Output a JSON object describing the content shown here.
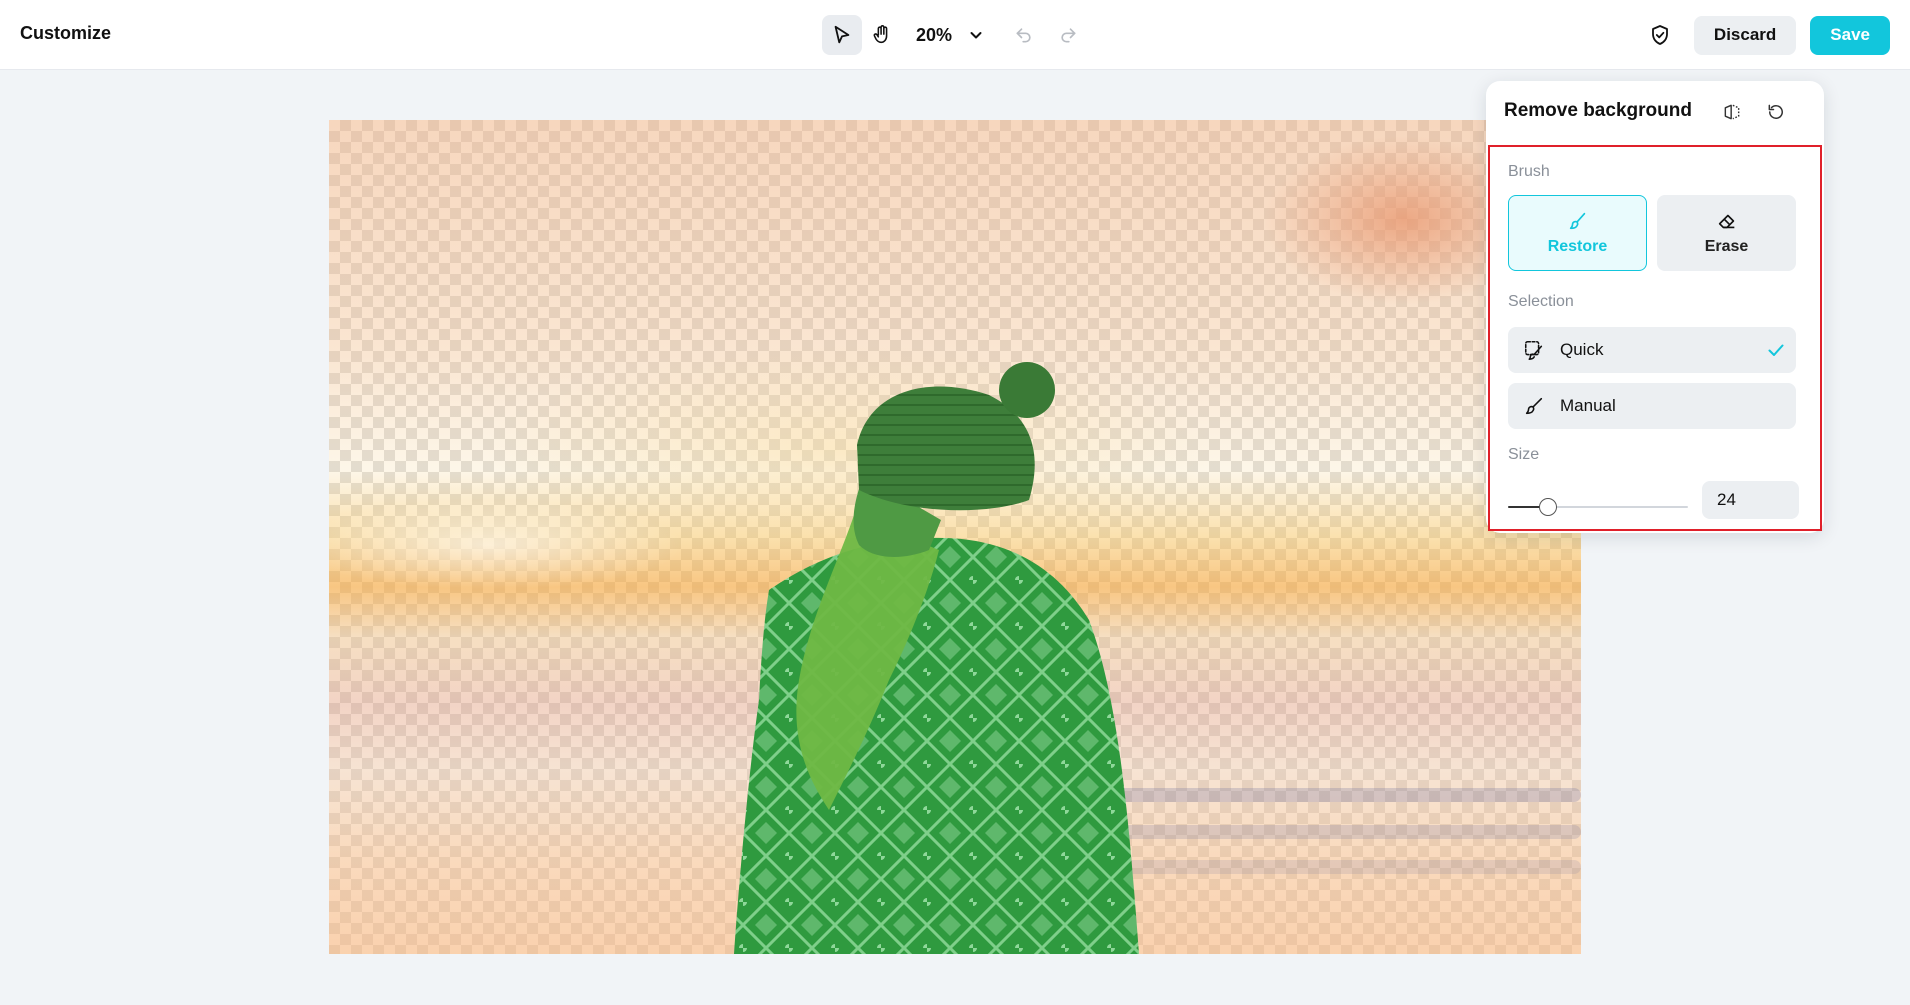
{
  "header": {
    "title": "Customize",
    "zoom": "20%",
    "discard_label": "Discard",
    "save_label": "Save"
  },
  "icons": {
    "select_tool": "cursor-arrow-icon",
    "pan_tool": "hand-icon",
    "zoom_menu": "chevron-down-icon",
    "undo": "undo-icon",
    "redo": "redo-icon",
    "privacy": "shield-check-icon",
    "compare": "compare-icon",
    "reset": "reset-icon",
    "restore": "brush-icon",
    "erase": "eraser-icon",
    "quick": "magic-select-icon",
    "manual": "brush-icon",
    "selected": "checkmark-icon"
  },
  "panel": {
    "title": "Remove background",
    "brush": {
      "label": "Brush",
      "options": [
        {
          "label": "Restore",
          "selected": true
        },
        {
          "label": "Erase",
          "selected": false
        }
      ]
    },
    "selection": {
      "label": "Selection",
      "options": [
        {
          "label": "Quick",
          "selected": true
        },
        {
          "label": "Manual",
          "selected": false
        }
      ]
    },
    "size": {
      "label": "Size",
      "value": "24",
      "slider_fraction": 0.22
    }
  },
  "colors": {
    "accent": "#12c6dc",
    "highlight_border": "#e0202a",
    "subject_overlay": "#2e9c3e"
  }
}
